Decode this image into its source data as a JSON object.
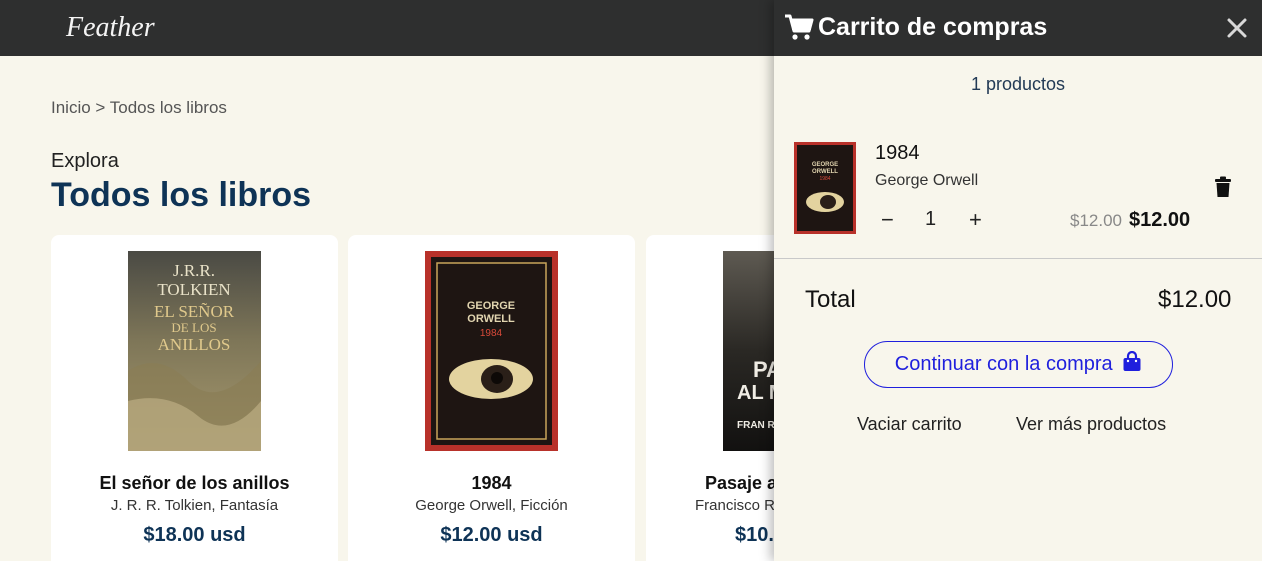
{
  "nav": {
    "brand": "Feather"
  },
  "breadcrumb": "Inicio > Todos los libros",
  "header": {
    "subtitle": "Explora",
    "title": "Todos los libros"
  },
  "books": [
    {
      "title": "El señor de los anillos",
      "meta": "J. R. R. Tolkien, Fantasía",
      "price": "$18.00 usd",
      "cover_lines": [
        "J.R.R.",
        "TOLKIEN",
        "EL SEÑOR",
        "DE LOS",
        "ANILLOS"
      ]
    },
    {
      "title": "1984",
      "meta": "George Orwell, Ficción",
      "price": "$12.00 usd",
      "cover_lines": [
        "GEORGE",
        "ORWELL",
        "1984"
      ]
    },
    {
      "title": "Pasaje a",
      "meta": "Francisco R",
      "price": "$10.",
      "cover_lines": [
        "PA",
        "AL M",
        "FRAN RE"
      ]
    }
  ],
  "cart": {
    "title": "Carrito de compras",
    "count_text": "1 productos",
    "item": {
      "title": "1984",
      "author": "George Orwell",
      "qty_minus": "−",
      "qty": "1",
      "qty_plus": "+",
      "old_price": "$12.00",
      "price": "$12.00",
      "thumb_lines": [
        "GEORGE",
        "ORWELL",
        "1984"
      ]
    },
    "total_label": "Total",
    "total_value": "$12.00",
    "continue_label": "Continuar con la compra",
    "clear_label": "Vaciar carrito",
    "more_label": "Ver más productos"
  },
  "colors": {
    "accent": "#1f1fdd",
    "heading": "#0e3356",
    "topbar": "#2e2f2f",
    "background": "#f8f6ec"
  }
}
